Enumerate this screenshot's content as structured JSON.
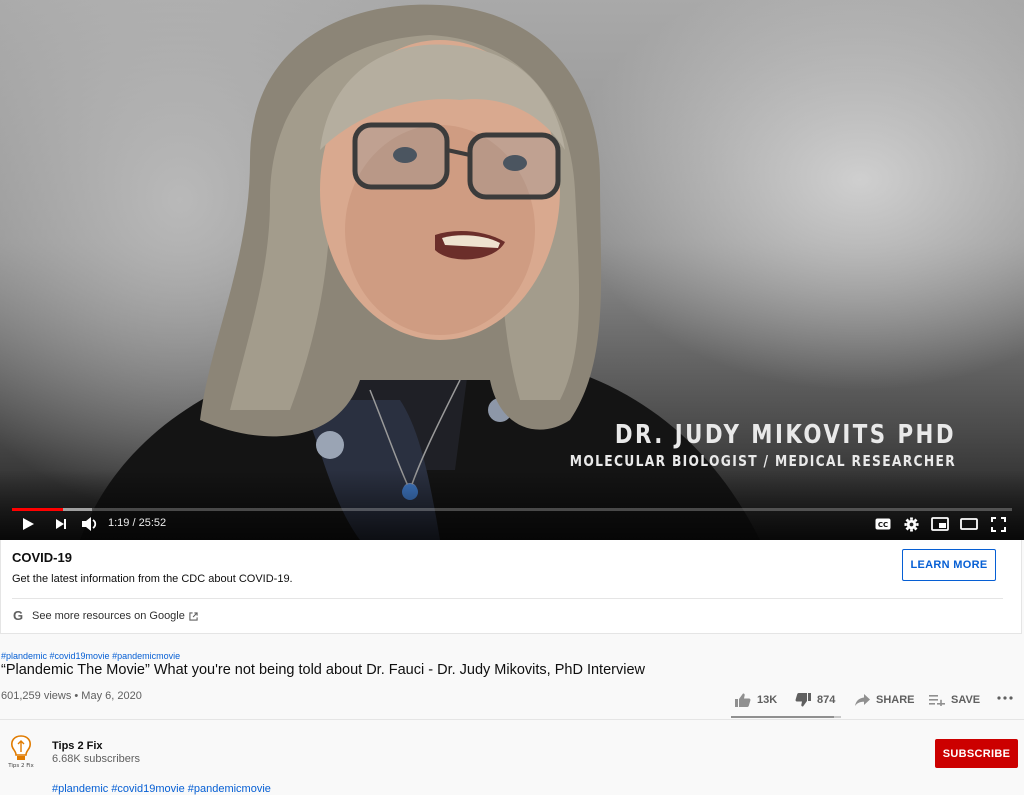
{
  "video": {
    "overlay_name": "DR. JUDY MIKOVITS PHD",
    "overlay_role": "MOLECULAR BIOLOGIST / MEDICAL RESEARCHER",
    "time_display": "1:19 / 25:52",
    "played_fraction": 0.051,
    "buffered_fraction": 0.08,
    "icons": [
      "play-icon",
      "next-icon",
      "volume-icon",
      "captions-icon",
      "settings-icon",
      "miniplayer-icon",
      "theater-icon",
      "fullscreen-icon"
    ]
  },
  "covid_panel": {
    "title": "COVID-19",
    "description": "Get the latest information from the CDC about COVID-19.",
    "learn_more_label": "LEARN MORE",
    "google_link": "See more resources on Google"
  },
  "info": {
    "hashtags": "#plandemic #covid19movie #pandemicmovie",
    "title": "“Plandemic The Movie” What you're not being told about Dr. Fauci - Dr. Judy Mikovits, PhD Interview",
    "meta": "601,259 views • May 6, 2020",
    "likes": "13K",
    "dislikes": "874",
    "like_fraction": 0.937,
    "share_label": "SHARE",
    "save_label": "SAVE",
    "more_label": "..."
  },
  "channel": {
    "name": "Tips 2 Fix",
    "subscribers": "6.68K subscribers",
    "avatar_text": "Tips 2 Fix",
    "subscribe_label": "SUBSCRIBE"
  },
  "description": {
    "hashtags": "#plandemic #covid19movie #pandemicmovie"
  },
  "colors": {
    "accent_red": "#cc0000",
    "link_blue": "#065fd4",
    "progress_red": "#ff0000"
  }
}
